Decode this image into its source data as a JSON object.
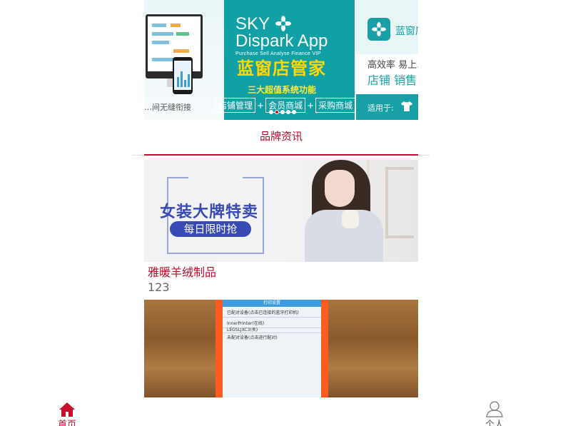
{
  "banner": {
    "slide_a": {
      "tagline": "…间无缝衔接",
      "app_title": "SKY",
      "app_title_2": "Dispark App",
      "app_subtitle": "Purchase  Sell  Analyse  Finance  VIP",
      "brand_cn": "蓝窗店管家",
      "feature_heading": "三大超值系统功能",
      "features": [
        "店铺管理",
        "会员商城",
        "采购商城"
      ]
    },
    "slide_b": {
      "app_name": "蓝窗店…",
      "efficiency": "高效率 易上…",
      "store_text": "店铺 销售…",
      "suitable_for": "适用于:"
    },
    "dots": {
      "count": 5,
      "active_index": 1
    },
    "colors": {
      "teal": "#11a0a6",
      "yellow": "#ffd800",
      "accent": "#c8102e"
    }
  },
  "section": {
    "title": "品牌资讯"
  },
  "articles": [
    {
      "image": {
        "headline": "女装大牌特卖",
        "pill": "每日限时抢"
      },
      "title": "雅暖羊绒制品",
      "summary": "123"
    },
    {
      "image": {
        "header": "打印设置",
        "lines": [
          "已配对设备(点击已连接的蓝牙打印机)",
          "InnerPrinter(在线)",
          "LEGSLJXC3(关)",
          "未配对设备(点击进行配对)"
        ]
      }
    }
  ],
  "tabbar": {
    "home_label": "首页",
    "me_label": "个人",
    "home_icon": "home-icon",
    "me_icon": "user-icon",
    "active_color": "#b50e2c"
  }
}
